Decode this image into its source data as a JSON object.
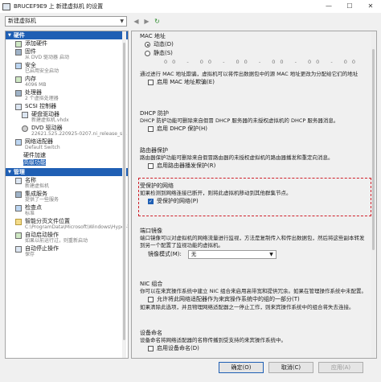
{
  "window": {
    "title": "BRUCEF9E9 上 新建虚拟机 的设置",
    "minimize": "—",
    "maximize": "☐",
    "close": "✕"
  },
  "toolbar": {
    "vm_name": "新建虚拟机",
    "back": "◀",
    "forward": "▶",
    "refresh": "↻"
  },
  "sidebar": {
    "hardware_header": "硬件",
    "management_header": "管理",
    "hardware_items": [
      {
        "label": "添加硬件",
        "sub": ""
      },
      {
        "label": "固件",
        "sub": "从 DVD 驱动器 启动"
      },
      {
        "label": "安全",
        "sub": "已启用安全启动"
      },
      {
        "label": "内存",
        "sub": "4096 MB"
      },
      {
        "label": "处理器",
        "sub": "2 个虚拟处理器"
      },
      {
        "label": "SCSI 控制器",
        "sub": ""
      }
    ],
    "scsi_children": [
      {
        "label": "硬盘驱动器",
        "sub": "新建虚拟机.vhdx"
      },
      {
        "label": "DVD 驱动器",
        "sub": "22621.525.220925-0207.ni_release_s..."
      }
    ],
    "network": {
      "label": "网络适配器",
      "sub": "Default Switch"
    },
    "network_children": [
      {
        "label": "硬件加速",
        "sub": ""
      },
      {
        "label": "高级功能",
        "sub": ""
      }
    ],
    "management_items": [
      {
        "label": "名称",
        "sub": "新建虚拟机"
      },
      {
        "label": "集成服务",
        "sub": "提供了一些服务"
      },
      {
        "label": "检查点",
        "sub": "标准"
      },
      {
        "label": "智能分页文件位置",
        "sub": "C:\\ProgramData\\Microsoft\\Windows\\Hyper-V"
      },
      {
        "label": "自动启动操作",
        "sub": "如果以前运行过，则重新启动"
      },
      {
        "label": "自动停止操作",
        "sub": "保存"
      }
    ]
  },
  "panel": {
    "mac_title": "MAC 地址",
    "mac_dynamic": "动态(D)",
    "mac_static": "静态(S)",
    "mac_value": "00 - 00 - 00 - 00 - 00 - 00",
    "mac_spoof_desc": "通过进行 MAC 地址欺骗，虚拟机可以将传出数据包中的源 MAC 地址更改为分配给它们的地址",
    "mac_spoof_check": "启用 MAC 地址欺骗(E)",
    "dhcp_title": "DHCP 防护",
    "dhcp_desc": "DHCP 防护功能可删除来自假冒 DHCP 服务器的未授权虚拟机的 DHCP 服务器消息。",
    "dhcp_check": "启用 DHCP 保护(H)",
    "router_title": "路由器保护",
    "router_desc": "路由器保护功能可删除来自假冒路由器的未授权虚拟机的路由器播发和重定向消息。",
    "router_check": "启用路由器播发保护(R)",
    "protected_title": "受保护的网络",
    "protected_desc": "如果检测到网络连接已断开，则将此虚拟机移动到其他群集节点。",
    "protected_check": "受保护的网络(P)",
    "port_title": "端口镜像",
    "port_desc": "端口镜像可以对虚拟机的网络流量进行监视，方法是复制传入和传出数据包，然后将这些副本转发到另一个配置了监视功能的虚拟机。",
    "mirror_label": "镜像模式(M):",
    "mirror_value": "无",
    "nic_title": "NIC 组合",
    "nic_desc": "你可以在来宾操作系统中建立 NIC 组合来启用高带宽和提供冗余。如果在管理操作系统中未配置。",
    "nic_check": "允许将此网络适配器作为来宾操作系统中的组的一部分(T)",
    "nic_desc2": "如果清除此选项，并且物理网络适配器之一停止工作，则来宾操作系统中的组合将失去连接。",
    "devname_title": "设备命名",
    "devname_desc": "设备命名将网络适配器的名称传播到受支持的来宾操作系统中。",
    "devname_check": "启用设备命名(D)"
  },
  "buttons": {
    "ok": "确定(O)",
    "cancel": "取消(C)",
    "apply": "应用(A)"
  }
}
